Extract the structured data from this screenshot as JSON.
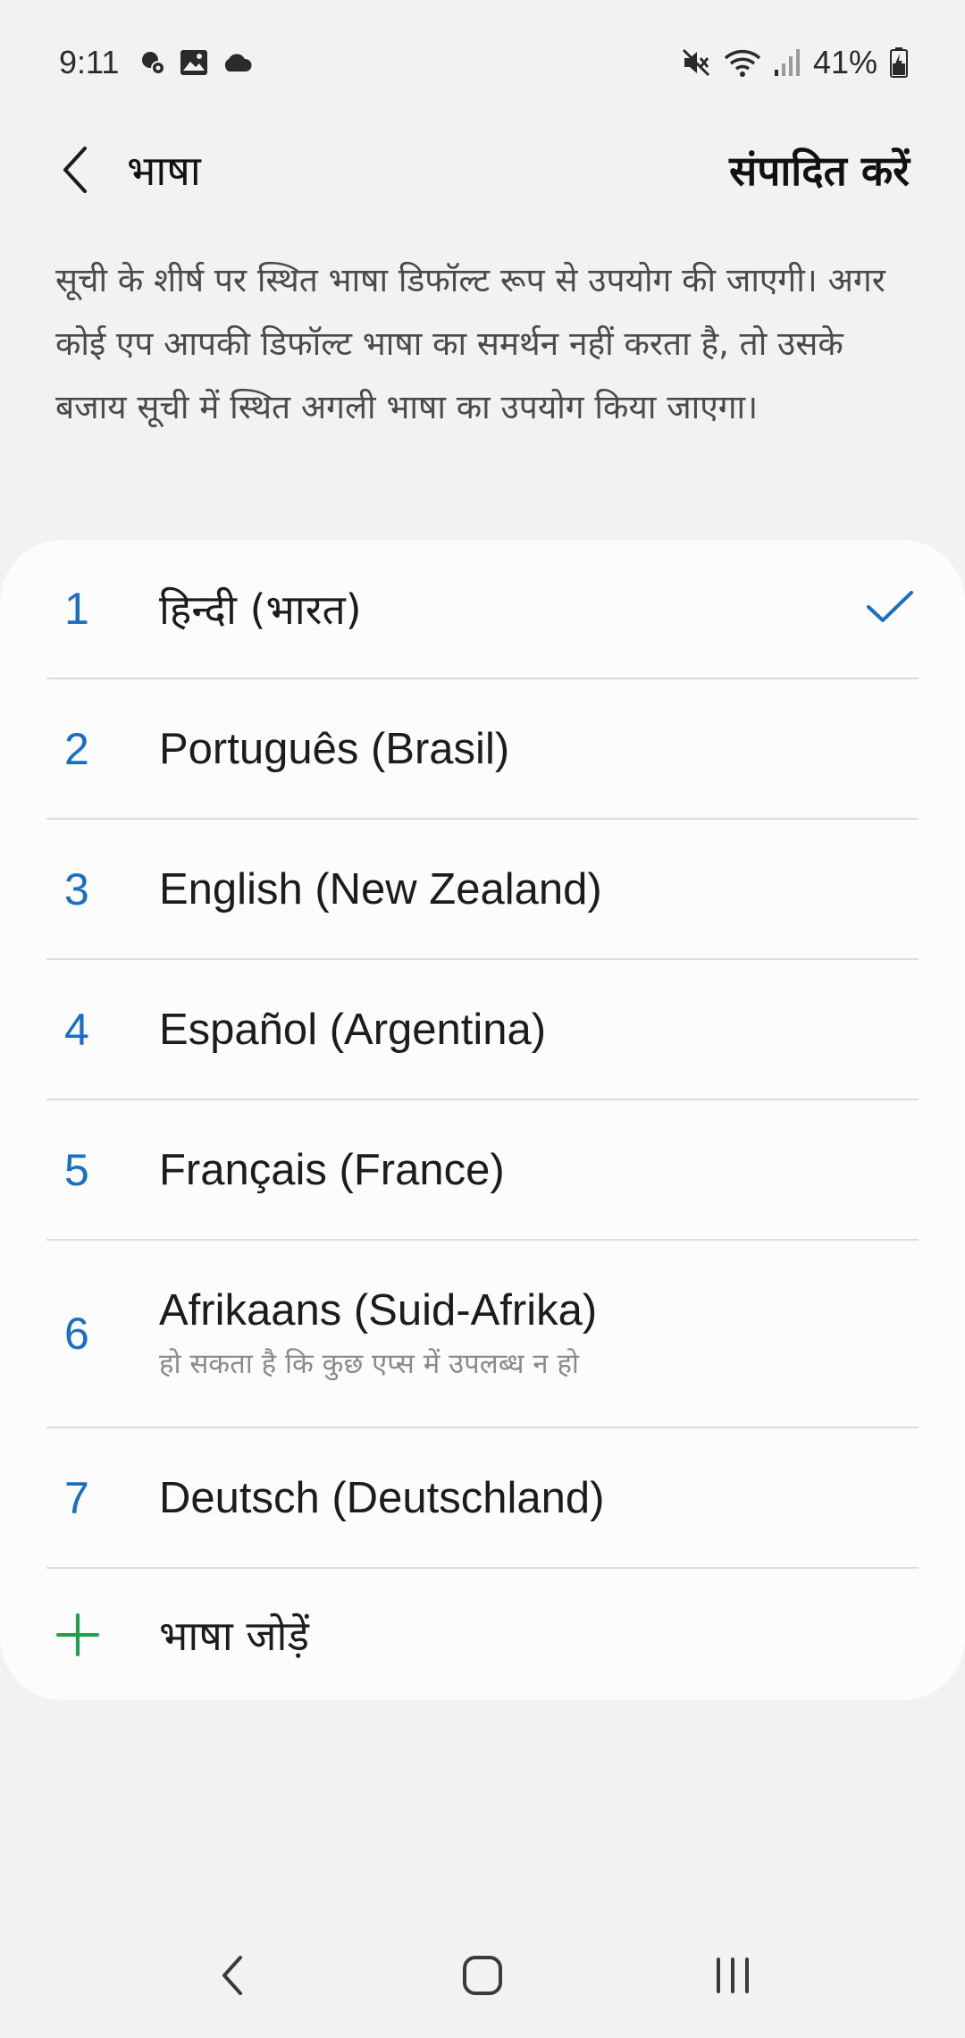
{
  "status_bar": {
    "time": "9:11",
    "battery": "41%",
    "left_icons": [
      "bixby-routine-icon",
      "gallery-icon",
      "cloud-icon"
    ],
    "right_icons": [
      "mute-icon",
      "wifi-icon",
      "signal-icon",
      "battery-charging-icon"
    ]
  },
  "header": {
    "title": "भाषा",
    "edit_label": "संपादित करें"
  },
  "description": "सूची के शीर्ष पर स्थित भाषा डिफॉल्ट रूप से उपयोग की जाएगी। अगर कोई एप आपकी डिफॉल्ट भाषा का समर्थन नहीं करता है, तो उसके बजाय सूची में स्थित अगली भाषा का उपयोग किया जाएगा।",
  "languages": [
    {
      "num": "1",
      "name": "हिन्दी (भारत)",
      "selected": true
    },
    {
      "num": "2",
      "name": "Português (Brasil)"
    },
    {
      "num": "3",
      "name": "English (New Zealand)"
    },
    {
      "num": "4",
      "name": "Español (Argentina)"
    },
    {
      "num": "5",
      "name": "Français (France)"
    },
    {
      "num": "6",
      "name": "Afrikaans (Suid-Afrika)",
      "note": "हो सकता है कि कुछ एप्स में उपलब्ध न हो"
    },
    {
      "num": "7",
      "name": "Deutsch (Deutschland)"
    }
  ],
  "add_language_label": "भाषा जोड़ें",
  "colors": {
    "accent_blue": "#1a6fc4",
    "add_green": "#1aa34a",
    "background": "#f2f2f2",
    "card": "#fcfcfc"
  },
  "nav_bar": [
    "back-nav-icon",
    "home-nav-icon",
    "recents-nav-icon"
  ]
}
